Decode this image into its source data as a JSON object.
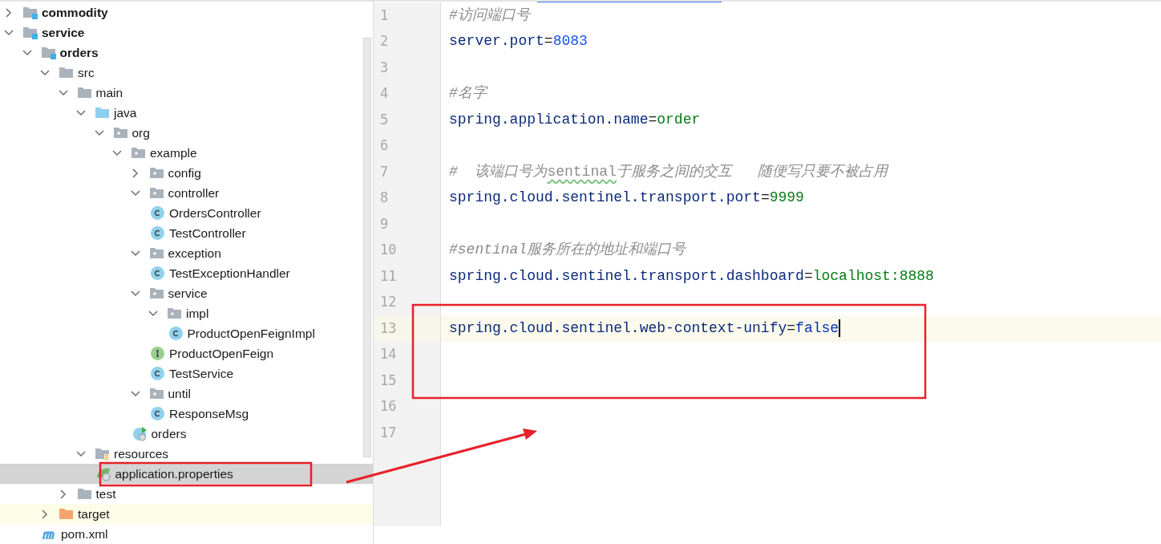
{
  "project_tree": [
    {
      "label": "commodity",
      "kind": "module",
      "expanded": false,
      "selected": false
    },
    {
      "label": "service",
      "kind": "module",
      "expanded": true,
      "selected": false,
      "children": [
        {
          "label": "orders",
          "kind": "module",
          "expanded": true,
          "selected": false,
          "children": [
            {
              "label": "src",
              "kind": "folder",
              "expanded": true,
              "selected": false,
              "children": [
                {
                  "label": "main",
                  "kind": "folder",
                  "expanded": true,
                  "selected": false,
                  "children": [
                    {
                      "label": "java",
                      "kind": "source",
                      "expanded": true,
                      "selected": false,
                      "children": [
                        {
                          "label": "org",
                          "kind": "package",
                          "expanded": true,
                          "selected": false,
                          "children": [
                            {
                              "label": "example",
                              "kind": "package",
                              "expanded": true,
                              "selected": false,
                              "children": [
                                {
                                  "label": "config",
                                  "kind": "package",
                                  "expanded": false,
                                  "selected": false
                                },
                                {
                                  "label": "controller",
                                  "kind": "package",
                                  "expanded": true,
                                  "selected": false,
                                  "children": [
                                    {
                                      "label": "OrdersController",
                                      "kind": "class",
                                      "selected": false
                                    },
                                    {
                                      "label": "TestController",
                                      "kind": "class",
                                      "selected": false
                                    }
                                  ]
                                },
                                {
                                  "label": "exception",
                                  "kind": "package",
                                  "expanded": true,
                                  "selected": false,
                                  "children": [
                                    {
                                      "label": "TestExceptionHandler",
                                      "kind": "class",
                                      "selected": false
                                    }
                                  ]
                                },
                                {
                                  "label": "service",
                                  "kind": "package",
                                  "expanded": true,
                                  "selected": false,
                                  "children": [
                                    {
                                      "label": "impl",
                                      "kind": "package",
                                      "expanded": true,
                                      "selected": false,
                                      "children": [
                                        {
                                          "label": "ProductOpenFeignImpl",
                                          "kind": "class",
                                          "selected": false
                                        }
                                      ]
                                    },
                                    {
                                      "label": "ProductOpenFeign",
                                      "kind": "interface",
                                      "selected": false
                                    },
                                    {
                                      "label": "TestService",
                                      "kind": "class",
                                      "selected": false
                                    }
                                  ]
                                },
                                {
                                  "label": "until",
                                  "kind": "package",
                                  "expanded": true,
                                  "selected": false,
                                  "children": [
                                    {
                                      "label": "ResponseMsg",
                                      "kind": "class",
                                      "selected": false
                                    }
                                  ]
                                },
                                {
                                  "label": "orders",
                                  "kind": "app",
                                  "selected": false
                                }
                              ]
                            }
                          ]
                        }
                      ]
                    },
                    {
                      "label": "resources",
                      "kind": "resources",
                      "expanded": true,
                      "selected": false,
                      "children": [
                        {
                          "label": "application.properties",
                          "kind": "properties",
                          "selected": true
                        }
                      ]
                    }
                  ]
                },
                {
                  "label": "test",
                  "kind": "folder",
                  "expanded": false,
                  "selected": false
                }
              ]
            },
            {
              "label": "target",
              "kind": "excluded",
              "expanded": false,
              "selected": false
            },
            {
              "label": "pom.xml",
              "kind": "maven",
              "selected": false
            }
          ]
        }
      ]
    }
  ],
  "editor": {
    "lines": [
      {
        "number": "1",
        "current": false,
        "tokens": [
          {
            "kind": "comment",
            "text": "#访问端口号"
          }
        ]
      },
      {
        "number": "2",
        "current": false,
        "tokens": [
          {
            "kind": "key",
            "text": "server.port"
          },
          {
            "kind": "sign",
            "text": "="
          },
          {
            "kind": "number",
            "text": "8083"
          }
        ]
      },
      {
        "number": "3",
        "current": false
      },
      {
        "number": "4",
        "current": false,
        "tokens": [
          {
            "kind": "comment",
            "text": "#名字"
          }
        ]
      },
      {
        "number": "5",
        "current": false,
        "tokens": [
          {
            "kind": "key",
            "text": "spring.application.name"
          },
          {
            "kind": "sign",
            "text": "="
          },
          {
            "kind": "value",
            "text": "order"
          }
        ]
      },
      {
        "number": "6",
        "current": false
      },
      {
        "number": "7",
        "current": false,
        "tokens": [
          {
            "kind": "comment",
            "text": "#  该端口号为"
          },
          {
            "kind": "typo",
            "text": "sentinal"
          },
          {
            "kind": "comment",
            "text": "于服务之间的交互   随便写只要不被占用"
          }
        ]
      },
      {
        "number": "8",
        "current": false,
        "tokens": [
          {
            "kind": "key",
            "text": "spring.cloud.sentinel.transport.port"
          },
          {
            "kind": "sign",
            "text": "="
          },
          {
            "kind": "value",
            "text": "9999"
          }
        ]
      },
      {
        "number": "9",
        "current": false
      },
      {
        "number": "10",
        "current": false,
        "tokens": [
          {
            "kind": "comment",
            "text": "#sentinal服务所在的地址和端口号"
          }
        ]
      },
      {
        "number": "11",
        "current": false,
        "tokens": [
          {
            "kind": "key",
            "text": "spring.cloud.sentinel.transport.dashboard"
          },
          {
            "kind": "sign",
            "text": "="
          },
          {
            "kind": "value",
            "text": "localhost:8888"
          }
        ]
      },
      {
        "number": "12",
        "current": false
      },
      {
        "number": "13",
        "current": true,
        "tokens": [
          {
            "kind": "key",
            "text": "spring.cloud.sentinel.web-context-unify"
          },
          {
            "kind": "sign",
            "text": "="
          },
          {
            "kind": "keyword",
            "text": "false"
          }
        ]
      },
      {
        "number": "14",
        "current": false
      },
      {
        "number": "15",
        "current": false
      },
      {
        "number": "16",
        "current": false
      },
      {
        "number": "17",
        "current": false
      }
    ]
  }
}
